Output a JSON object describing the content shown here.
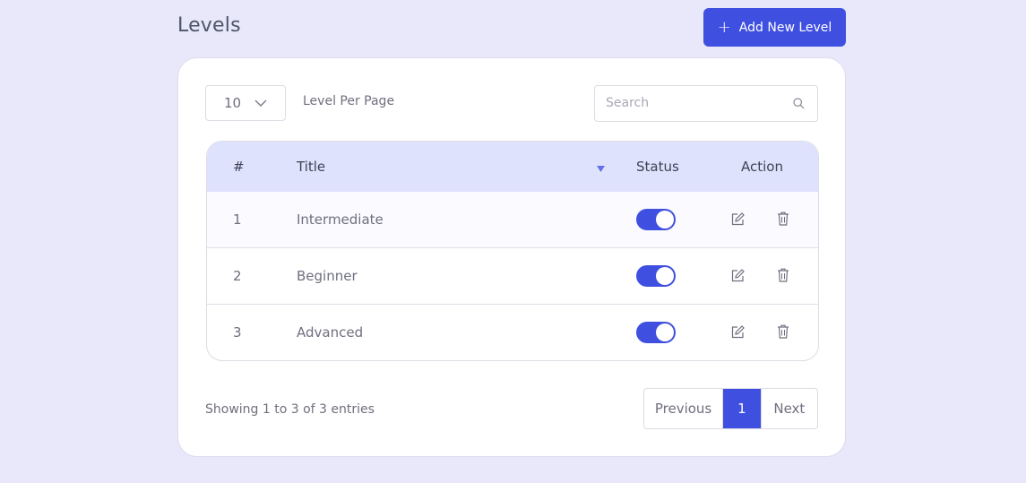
{
  "page": {
    "title": "Levels",
    "add_button_label": "Add New Level"
  },
  "controls": {
    "per_page_value": "10",
    "per_page_label": "Level Per Page",
    "search_placeholder": "Search"
  },
  "table": {
    "headers": {
      "num": "#",
      "title": "Title",
      "status": "Status",
      "action": "Action"
    },
    "rows": [
      {
        "num": "1",
        "title": "Intermediate",
        "status_on": true
      },
      {
        "num": "2",
        "title": "Beginner",
        "status_on": true
      },
      {
        "num": "3",
        "title": "Advanced",
        "status_on": true
      }
    ]
  },
  "footer": {
    "showing_text": "Showing 1 to 3 of 3 entries",
    "prev_label": "Previous",
    "current_page": "1",
    "next_label": "Next"
  },
  "colors": {
    "accent": "#3f4fe0",
    "header_bg": "#dfe2fd",
    "page_bg": "#e8e8fa"
  },
  "icons": [
    "plus-icon",
    "chevron-down-icon",
    "search-icon",
    "sort-down-icon",
    "edit-icon",
    "trash-icon"
  ]
}
